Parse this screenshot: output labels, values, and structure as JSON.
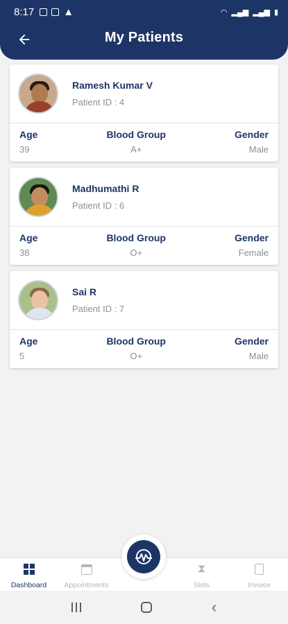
{
  "status_bar": {
    "time": "8:17"
  },
  "app_bar": {
    "title": "My Patients",
    "back_icon": "arrow-left-icon"
  },
  "patients": [
    {
      "name": "Ramesh Kumar V",
      "patient_id": "Patient ID : 4",
      "age_label": "Age",
      "age": "39",
      "blood_label": "Blood Group",
      "blood_group": "A+",
      "gender_label": "Gender",
      "gender": "Male"
    },
    {
      "name": "Madhumathi R",
      "patient_id": "Patient ID : 6",
      "age_label": "Age",
      "age": "38",
      "blood_label": "Blood Group",
      "blood_group": "O+",
      "gender_label": "Gender",
      "gender": "Female"
    },
    {
      "name": "Sai R",
      "patient_id": "Patient ID : 7",
      "age_label": "Age",
      "age": "5",
      "blood_label": "Blood Group",
      "blood_group": "O+",
      "gender_label": "Gender",
      "gender": "Male"
    }
  ],
  "bottom_nav": {
    "dashboard": "Dashboard",
    "appointments": "Appointments",
    "slots": "Slots",
    "invoice": "Invoice"
  },
  "colors": {
    "primary": "#1d3566",
    "muted": "#8a8f98",
    "background": "#f2f2f3"
  }
}
